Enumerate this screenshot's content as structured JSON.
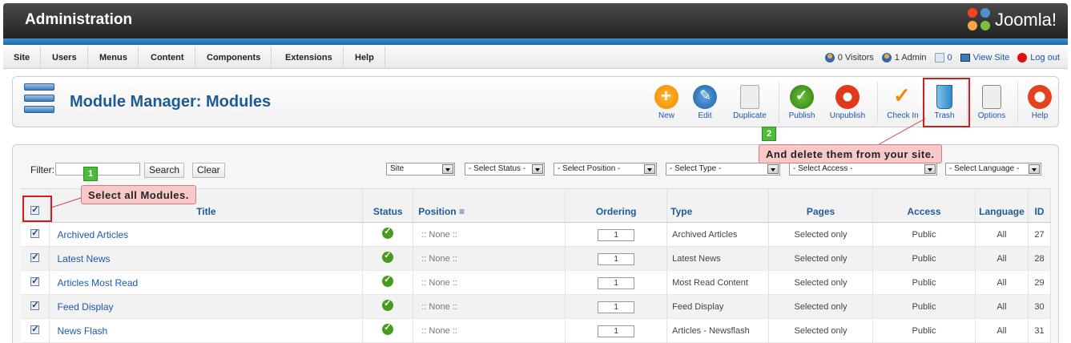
{
  "header": {
    "title": "Administration",
    "logo_text": "Joomla!"
  },
  "menu": {
    "items": [
      "Site",
      "Users",
      "Menus",
      "Content",
      "Components",
      "Extensions",
      "Help"
    ],
    "status": {
      "visitors": "0 Visitors",
      "admins": "1 Admin",
      "messages": "0",
      "view_site": "View Site",
      "logout": "Log out"
    }
  },
  "toolbar": {
    "page_title": "Module Manager: Modules",
    "buttons": {
      "new": "New",
      "edit": "Edit",
      "duplicate": "Duplicate",
      "publish": "Publish",
      "unpublish": "Unpublish",
      "checkin": "Check In",
      "trash": "Trash",
      "options": "Options",
      "help": "Help"
    }
  },
  "filter": {
    "label": "Filter:",
    "value": "",
    "search_label": "Search",
    "clear_label": "Clear",
    "selects": {
      "site": "Site",
      "status": "- Select Status -",
      "position": "- Select Position -",
      "type": "- Select Type -",
      "access": "- Select Access -",
      "language": "- Select Language -"
    }
  },
  "table": {
    "headers": {
      "title": "Title",
      "status": "Status",
      "position": "Position",
      "ordering": "Ordering",
      "type": "Type",
      "pages": "Pages",
      "access": "Access",
      "language": "Language",
      "id": "ID"
    },
    "rows": [
      {
        "title": "Archived Articles",
        "position": ":: None ::",
        "ordering": "1",
        "type": "Archived Articles",
        "pages": "Selected only",
        "access": "Public",
        "language": "All",
        "id": "27"
      },
      {
        "title": "Latest News",
        "position": ":: None ::",
        "ordering": "1",
        "type": "Latest News",
        "pages": "Selected only",
        "access": "Public",
        "language": "All",
        "id": "28"
      },
      {
        "title": "Articles Most Read",
        "position": ":: None ::",
        "ordering": "1",
        "type": "Most Read Content",
        "pages": "Selected only",
        "access": "Public",
        "language": "All",
        "id": "29"
      },
      {
        "title": "Feed Display",
        "position": ":: None ::",
        "ordering": "1",
        "type": "Feed Display",
        "pages": "Selected only",
        "access": "Public",
        "language": "All",
        "id": "30"
      },
      {
        "title": "News Flash",
        "position": ":: None ::",
        "ordering": "1",
        "type": "Articles - Newsflash",
        "pages": "Selected only",
        "access": "Public",
        "language": "All",
        "id": "31"
      }
    ]
  },
  "annotations": {
    "step1": {
      "number": "1",
      "text": "Select all Modules."
    },
    "step2": {
      "number": "2",
      "text": "And delete them from your site."
    }
  },
  "colors": {
    "accent": "#1e5b94",
    "highlight": "#d21d1d",
    "callout_bg": "#f9c9c9",
    "badge": "#4cbc3a"
  }
}
